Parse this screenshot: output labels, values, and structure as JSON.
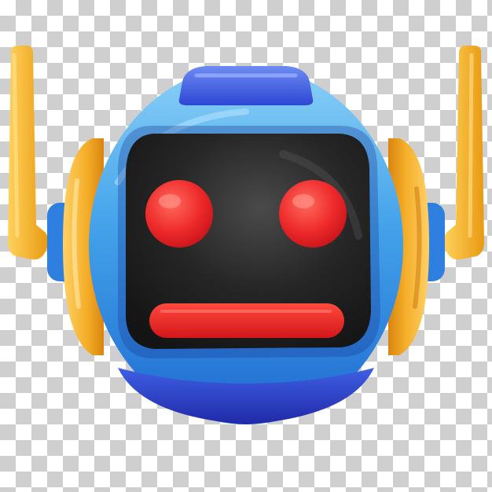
{
  "image": {
    "subject": "robot-head-icon",
    "background": "transparency-checkerboard",
    "colors": {
      "checker_light": "#ffffff",
      "checker_dark": "#cfcfcf",
      "shell_blue": "#3f9be8",
      "shell_blue_light": "#7cc4f5",
      "shell_blue_dark": "#1f6fcf",
      "cap_blue": "#3a5fe0",
      "cap_blue_dark": "#2332b8",
      "ear_yellow": "#f4b02a",
      "ear_yellow_dark": "#e08a10",
      "antenna_yellow": "#f2b021",
      "visor_black": "#232323",
      "eye_red": "#ee2a2a",
      "mouth_red": "#e8241f"
    },
    "parts": [
      "antenna-left",
      "antenna-right",
      "ear-left",
      "ear-right",
      "head-shell",
      "top-cap",
      "bottom-cap",
      "visor",
      "eye-left",
      "eye-right",
      "mouth"
    ]
  }
}
